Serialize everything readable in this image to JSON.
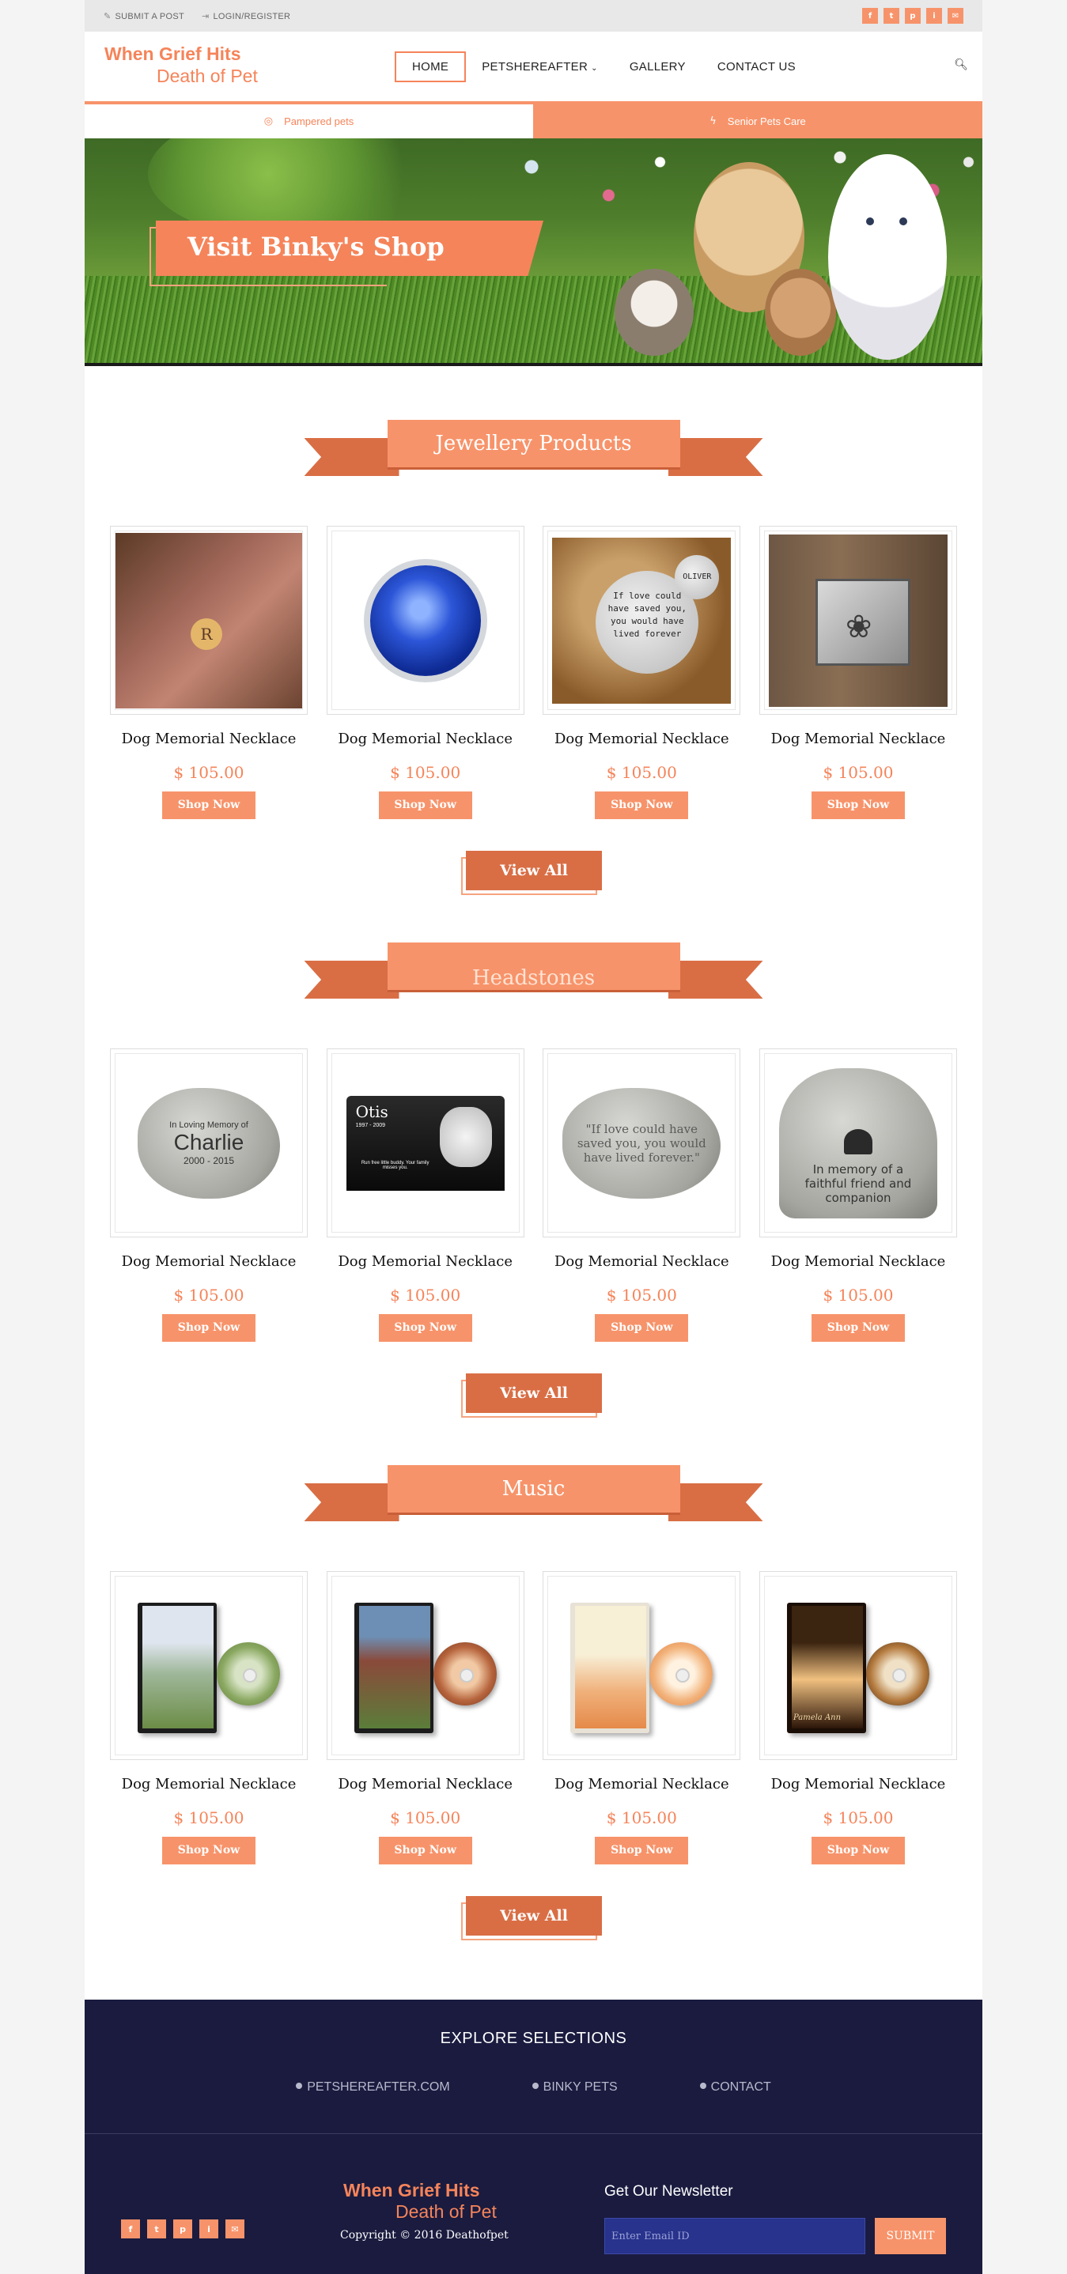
{
  "topbar": {
    "submit_post": "SUBMIT A POST",
    "login": "LOGIN/REGISTER",
    "social": [
      "f",
      "t",
      "p",
      "i",
      "✉"
    ]
  },
  "logo": {
    "line1": "When Grief Hits",
    "line2": "Death of Pet"
  },
  "nav": {
    "items": [
      {
        "label": "HOME"
      },
      {
        "label": "PETSHEREAFTER"
      },
      {
        "label": "GALLERY"
      },
      {
        "label": "CONTACT US"
      }
    ],
    "caret": "⌄"
  },
  "subbar": {
    "left": "Pampered pets",
    "right": "Senior Pets Care"
  },
  "hero": {
    "banner": "Visit Binky's Shop"
  },
  "sections": [
    {
      "title": "Jewellery Products",
      "products": [
        {
          "name": "Dog Memorial Necklace",
          "price": "$ 105.00",
          "button": "Shop Now"
        },
        {
          "name": "Dog Memorial Necklace",
          "price": "$ 105.00",
          "button": "Shop Now"
        },
        {
          "name": "Dog Memorial Necklace",
          "price": "$ 105.00",
          "button": "Shop Now"
        },
        {
          "name": "Dog Memorial Necklace",
          "price": "$ 105.00",
          "button": "Shop Now"
        }
      ],
      "view_all": "View All"
    },
    {
      "title": "Headstones",
      "products": [
        {
          "name": "Dog Memorial Necklace",
          "price": "$ 105.00",
          "button": "Shop Now"
        },
        {
          "name": "Dog Memorial Necklace",
          "price": "$ 105.00",
          "button": "Shop Now"
        },
        {
          "name": "Dog Memorial Necklace",
          "price": "$ 105.00",
          "button": "Shop Now"
        },
        {
          "name": "Dog Memorial Necklace",
          "price": "$ 105.00",
          "button": "Shop Now"
        }
      ],
      "view_all": "View All"
    },
    {
      "title": "Music",
      "products": [
        {
          "name": "Dog Memorial Necklace",
          "price": "$ 105.00",
          "button": "Shop Now"
        },
        {
          "name": "Dog Memorial Necklace",
          "price": "$ 105.00",
          "button": "Shop Now"
        },
        {
          "name": "Dog Memorial Necklace",
          "price": "$ 105.00",
          "button": "Shop Now"
        },
        {
          "name": "Dog Memorial Necklace",
          "price": "$ 105.00",
          "button": "Shop Now"
        }
      ],
      "view_all": "View All"
    }
  ],
  "image_text": {
    "charm": "R",
    "tag_main": "If love could have saved you, you would have lived forever",
    "tag_small": "OLIVER",
    "stone1_top": "In Loving Memory of",
    "stone1_name": "Charlie",
    "stone1_years": "2000 - 2015",
    "slab_name": "Otis",
    "slab_years": "1997 - 2009",
    "slab_text": "Run free little buddy. Your family misses you.",
    "stone3": "\"If love could have saved you, you would have lived forever.\"",
    "stone4": "In memory of a faithful friend and companion",
    "dvd4_name": "Pamela Ann"
  },
  "footer": {
    "explore_title": "EXPLORE SELECTIONS",
    "links": [
      "PETSHEREAFTER.COM",
      "BINKY PETS",
      "CONTACT"
    ],
    "copyright": "Copyright © 2016 Deathofpet",
    "newsletter_title": "Get Our Newsletter",
    "email_placeholder": "Enter Email ID",
    "submit": "SUBMIT"
  },
  "colors": {
    "accent": "#f7936a",
    "accent_dark": "#d96e45",
    "footer_bg": "#1a1b3f"
  }
}
